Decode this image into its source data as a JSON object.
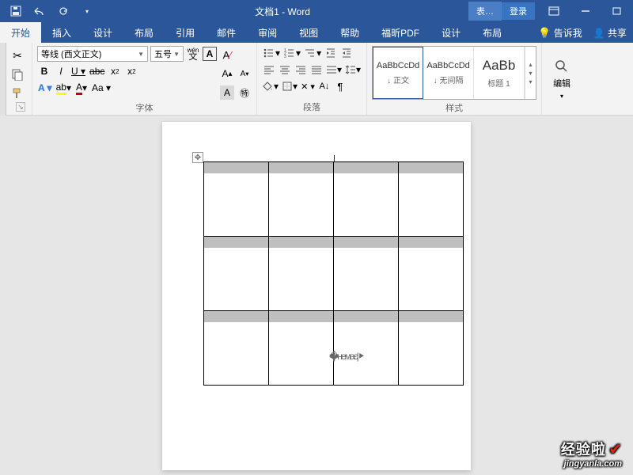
{
  "title": "文档1 - Word",
  "context_tab": "表…",
  "login": "登录",
  "tabs": {
    "home": "开始",
    "insert": "插入",
    "design": "设计",
    "layout": "布局",
    "references": "引用",
    "mailings": "邮件",
    "review": "审阅",
    "view": "视图",
    "help": "帮助",
    "foxit": "福昕PDF",
    "table_design": "设计",
    "table_layout": "布局"
  },
  "tell_me": "告诉我",
  "share": "共享",
  "font": {
    "name": "等线 (西文正文)",
    "size": "五号"
  },
  "groups": {
    "font": "字体",
    "paragraph": "段落",
    "styles": "样式",
    "edit": "编辑"
  },
  "pinyin": "wén",
  "char_box": "A",
  "styles": [
    {
      "sample": "AaBbCcDd",
      "name": "↓ 正文"
    },
    {
      "sample": "AaBbCcDd",
      "name": "↓ 无间隔"
    },
    {
      "sample": "AaBb",
      "name": "标题 1"
    }
  ],
  "watermark": {
    "big": "经验啦",
    "small": "jingyanla.com"
  }
}
